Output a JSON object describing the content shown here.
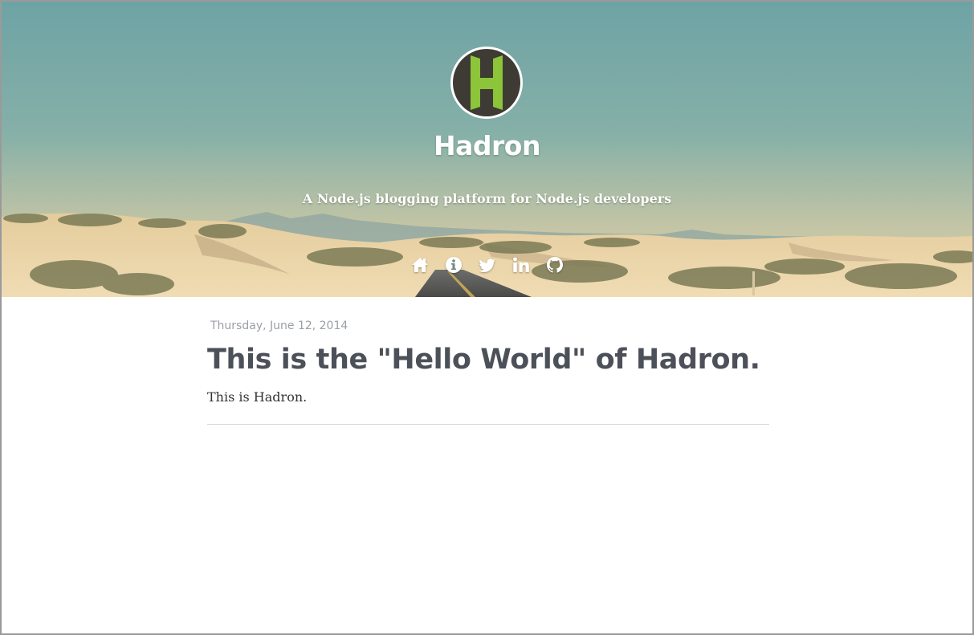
{
  "site": {
    "title": "Hadron",
    "tagline": "A Node.js blogging platform for Node.js developers",
    "logo_letter": "H"
  },
  "colors": {
    "sky_top": "#6fa6a6",
    "sky_bottom": "#cfc8a2",
    "sand": "#e9d3a8",
    "logo_bg": "#3d3b33",
    "logo_accent": "#8cc43a",
    "title_text": "#4c5159",
    "date_text": "#9a9fa6"
  },
  "nav": [
    {
      "icon": "home-icon"
    },
    {
      "icon": "info-icon"
    },
    {
      "icon": "twitter-icon"
    },
    {
      "icon": "linkedin-icon"
    },
    {
      "icon": "github-icon"
    }
  ],
  "post": {
    "date": "Thursday, June 12, 2014",
    "title": "This is the \"Hello World\" of Hadron.",
    "body": "This is Hadron."
  }
}
